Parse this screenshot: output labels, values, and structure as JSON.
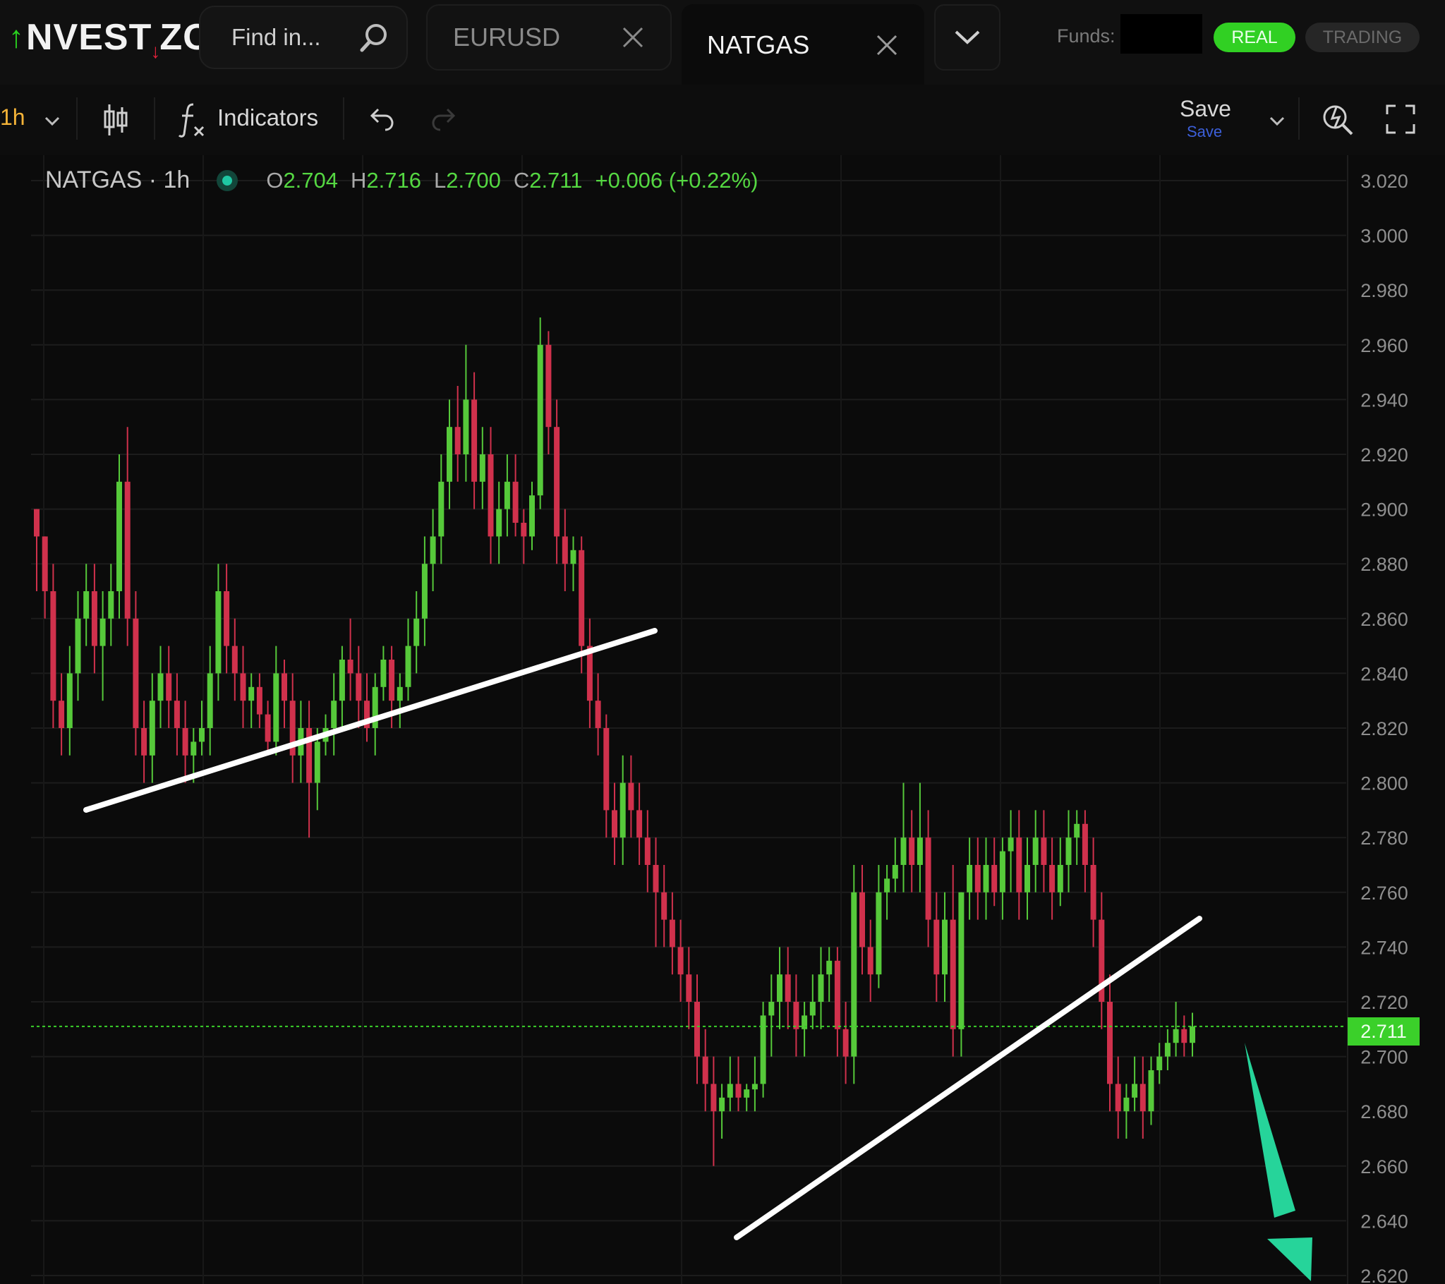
{
  "app": {
    "brand": "INVESTIZO"
  },
  "search": {
    "placeholder": "Find in..."
  },
  "tabs": [
    {
      "label": "EURUSD",
      "active": false
    },
    {
      "label": "NATGAS",
      "active": true
    }
  ],
  "account": {
    "funds_label": "Funds:",
    "mode_real": "REAL",
    "mode_trading": "TRADING"
  },
  "toolbar": {
    "interval": "1h",
    "indicators_label": "Indicators",
    "save_label": "Save",
    "save_sub": "Save"
  },
  "legend": {
    "symbol": "NATGAS · 1h",
    "open_prefix": "O",
    "open": "2.704",
    "high_prefix": "H",
    "high": "2.716",
    "low_prefix": "L",
    "low": "2.700",
    "close_prefix": "C",
    "close": "2.711",
    "change": "+0.006 (+0.22%)"
  },
  "colors": {
    "up": "#56c93a",
    "down": "#d0314c",
    "accent": "#31d023",
    "last_price": "#3bd02a"
  },
  "chart_data": {
    "type": "candlestick",
    "symbol": "NATGAS",
    "timeframe": "1h",
    "ylim": [
      2.62,
      3.02
    ],
    "y_ticks": [
      "3.020",
      "3.000",
      "2.980",
      "2.960",
      "2.940",
      "2.920",
      "2.900",
      "2.880",
      "2.860",
      "2.840",
      "2.820",
      "2.800",
      "2.780",
      "2.760",
      "2.740",
      "2.720",
      "2.700",
      "2.680",
      "2.660",
      "2.640",
      "2.620"
    ],
    "last_price": "2.711",
    "series": [
      {
        "values": [
          [
            2.9,
            2.9,
            2.87,
            2.89
          ],
          [
            2.89,
            2.89,
            2.86,
            2.87
          ],
          [
            2.87,
            2.88,
            2.82,
            2.83
          ],
          [
            2.83,
            2.84,
            2.81,
            2.82
          ],
          [
            2.82,
            2.85,
            2.81,
            2.84
          ],
          [
            2.84,
            2.87,
            2.83,
            2.86
          ],
          [
            2.86,
            2.88,
            2.85,
            2.87
          ],
          [
            2.87,
            2.88,
            2.84,
            2.85
          ],
          [
            2.85,
            2.87,
            2.83,
            2.86
          ],
          [
            2.86,
            2.88,
            2.85,
            2.87
          ],
          [
            2.87,
            2.92,
            2.86,
            2.91
          ],
          [
            2.91,
            2.93,
            2.85,
            2.86
          ],
          [
            2.86,
            2.87,
            2.81,
            2.82
          ],
          [
            2.82,
            2.83,
            2.8,
            2.81
          ],
          [
            2.81,
            2.84,
            2.8,
            2.83
          ],
          [
            2.83,
            2.85,
            2.82,
            2.84
          ],
          [
            2.84,
            2.85,
            2.82,
            2.83
          ],
          [
            2.83,
            2.84,
            2.81,
            2.82
          ],
          [
            2.82,
            2.83,
            2.8,
            2.81
          ],
          [
            2.81,
            2.82,
            2.8,
            2.815
          ],
          [
            2.815,
            2.83,
            2.81,
            2.82
          ],
          [
            2.82,
            2.85,
            2.81,
            2.84
          ],
          [
            2.84,
            2.88,
            2.83,
            2.87
          ],
          [
            2.87,
            2.88,
            2.84,
            2.85
          ],
          [
            2.85,
            2.86,
            2.83,
            2.84
          ],
          [
            2.84,
            2.85,
            2.82,
            2.83
          ],
          [
            2.83,
            2.84,
            2.82,
            2.835
          ],
          [
            2.835,
            2.84,
            2.82,
            2.825
          ],
          [
            2.825,
            2.83,
            2.81,
            2.815
          ],
          [
            2.815,
            2.85,
            2.81,
            2.84
          ],
          [
            2.84,
            2.845,
            2.82,
            2.83
          ],
          [
            2.83,
            2.84,
            2.8,
            2.81
          ],
          [
            2.81,
            2.83,
            2.8,
            2.82
          ],
          [
            2.82,
            2.83,
            2.78,
            2.8
          ],
          [
            2.8,
            2.82,
            2.79,
            2.815
          ],
          [
            2.815,
            2.825,
            2.81,
            2.82
          ],
          [
            2.82,
            2.84,
            2.81,
            2.83
          ],
          [
            2.83,
            2.85,
            2.82,
            2.845
          ],
          [
            2.845,
            2.86,
            2.83,
            2.84
          ],
          [
            2.84,
            2.85,
            2.82,
            2.83
          ],
          [
            2.83,
            2.84,
            2.815,
            2.82
          ],
          [
            2.82,
            2.84,
            2.81,
            2.835
          ],
          [
            2.835,
            2.85,
            2.83,
            2.845
          ],
          [
            2.845,
            2.85,
            2.82,
            2.83
          ],
          [
            2.83,
            2.84,
            2.82,
            2.835
          ],
          [
            2.835,
            2.86,
            2.83,
            2.85
          ],
          [
            2.85,
            2.87,
            2.84,
            2.86
          ],
          [
            2.86,
            2.89,
            2.85,
            2.88
          ],
          [
            2.88,
            2.9,
            2.87,
            2.89
          ],
          [
            2.89,
            2.92,
            2.88,
            2.91
          ],
          [
            2.91,
            2.94,
            2.9,
            2.93
          ],
          [
            2.93,
            2.945,
            2.91,
            2.92
          ],
          [
            2.92,
            2.96,
            2.91,
            2.94
          ],
          [
            2.94,
            2.95,
            2.9,
            2.91
          ],
          [
            2.91,
            2.93,
            2.9,
            2.92
          ],
          [
            2.92,
            2.93,
            2.88,
            2.89
          ],
          [
            2.89,
            2.91,
            2.88,
            2.9
          ],
          [
            2.9,
            2.92,
            2.89,
            2.91
          ],
          [
            2.91,
            2.92,
            2.89,
            2.895
          ],
          [
            2.895,
            2.9,
            2.88,
            2.89
          ],
          [
            2.89,
            2.91,
            2.885,
            2.905
          ],
          [
            2.905,
            2.97,
            2.9,
            2.96
          ],
          [
            2.96,
            2.965,
            2.92,
            2.93
          ],
          [
            2.93,
            2.94,
            2.88,
            2.89
          ],
          [
            2.89,
            2.9,
            2.87,
            2.88
          ],
          [
            2.88,
            2.89,
            2.87,
            2.885
          ],
          [
            2.885,
            2.89,
            2.84,
            2.85
          ],
          [
            2.85,
            2.86,
            2.82,
            2.83
          ],
          [
            2.83,
            2.84,
            2.81,
            2.82
          ],
          [
            2.82,
            2.825,
            2.78,
            2.79
          ],
          [
            2.79,
            2.8,
            2.77,
            2.78
          ],
          [
            2.78,
            2.81,
            2.77,
            2.8
          ],
          [
            2.8,
            2.81,
            2.78,
            2.79
          ],
          [
            2.79,
            2.8,
            2.77,
            2.78
          ],
          [
            2.78,
            2.79,
            2.76,
            2.77
          ],
          [
            2.77,
            2.78,
            2.74,
            2.76
          ],
          [
            2.76,
            2.77,
            2.74,
            2.75
          ],
          [
            2.75,
            2.76,
            2.73,
            2.74
          ],
          [
            2.74,
            2.75,
            2.72,
            2.73
          ],
          [
            2.73,
            2.74,
            2.71,
            2.72
          ],
          [
            2.72,
            2.73,
            2.69,
            2.7
          ],
          [
            2.7,
            2.71,
            2.68,
            2.69
          ],
          [
            2.69,
            2.7,
            2.66,
            2.68
          ],
          [
            2.68,
            2.69,
            2.67,
            2.685
          ],
          [
            2.685,
            2.7,
            2.68,
            2.69
          ],
          [
            2.69,
            2.7,
            2.68,
            2.685
          ],
          [
            2.685,
            2.69,
            2.68,
            2.688
          ],
          [
            2.688,
            2.7,
            2.68,
            2.69
          ],
          [
            2.69,
            2.72,
            2.685,
            2.715
          ],
          [
            2.715,
            2.73,
            2.7,
            2.72
          ],
          [
            2.72,
            2.74,
            2.71,
            2.73
          ],
          [
            2.73,
            2.74,
            2.71,
            2.72
          ],
          [
            2.72,
            2.73,
            2.7,
            2.71
          ],
          [
            2.71,
            2.72,
            2.7,
            2.715
          ],
          [
            2.715,
            2.73,
            2.71,
            2.72
          ],
          [
            2.72,
            2.74,
            2.71,
            2.73
          ],
          [
            2.73,
            2.74,
            2.72,
            2.735
          ],
          [
            2.735,
            2.74,
            2.7,
            2.71
          ],
          [
            2.71,
            2.72,
            2.69,
            2.7
          ],
          [
            2.7,
            2.77,
            2.69,
            2.76
          ],
          [
            2.76,
            2.77,
            2.73,
            2.74
          ],
          [
            2.74,
            2.75,
            2.72,
            2.73
          ],
          [
            2.73,
            2.77,
            2.725,
            2.76
          ],
          [
            2.76,
            2.77,
            2.75,
            2.765
          ],
          [
            2.765,
            2.78,
            2.76,
            2.77
          ],
          [
            2.77,
            2.8,
            2.76,
            2.78
          ],
          [
            2.78,
            2.79,
            2.76,
            2.77
          ],
          [
            2.77,
            2.8,
            2.76,
            2.78
          ],
          [
            2.78,
            2.79,
            2.74,
            2.75
          ],
          [
            2.75,
            2.76,
            2.72,
            2.73
          ],
          [
            2.73,
            2.76,
            2.72,
            2.75
          ],
          [
            2.75,
            2.77,
            2.7,
            2.71
          ],
          [
            2.71,
            2.76,
            2.7,
            2.76
          ],
          [
            2.76,
            2.78,
            2.75,
            2.77
          ],
          [
            2.77,
            2.78,
            2.75,
            2.76
          ],
          [
            2.76,
            2.78,
            2.75,
            2.77
          ],
          [
            2.77,
            2.78,
            2.755,
            2.76
          ],
          [
            2.76,
            2.78,
            2.75,
            2.775
          ],
          [
            2.775,
            2.79,
            2.76,
            2.78
          ],
          [
            2.78,
            2.79,
            2.75,
            2.76
          ],
          [
            2.76,
            2.78,
            2.75,
            2.77
          ],
          [
            2.77,
            2.79,
            2.76,
            2.78
          ],
          [
            2.78,
            2.79,
            2.76,
            2.77
          ],
          [
            2.77,
            2.78,
            2.75,
            2.76
          ],
          [
            2.76,
            2.78,
            2.755,
            2.77
          ],
          [
            2.77,
            2.79,
            2.76,
            2.78
          ],
          [
            2.78,
            2.79,
            2.77,
            2.785
          ],
          [
            2.785,
            2.79,
            2.76,
            2.77
          ],
          [
            2.77,
            2.78,
            2.74,
            2.75
          ],
          [
            2.75,
            2.76,
            2.71,
            2.72
          ],
          [
            2.72,
            2.73,
            2.68,
            2.69
          ],
          [
            2.69,
            2.7,
            2.67,
            2.68
          ],
          [
            2.68,
            2.69,
            2.67,
            2.685
          ],
          [
            2.685,
            2.7,
            2.68,
            2.69
          ],
          [
            2.69,
            2.7,
            2.67,
            2.68
          ],
          [
            2.68,
            2.7,
            2.675,
            2.695
          ],
          [
            2.695,
            2.705,
            2.69,
            2.7
          ],
          [
            2.7,
            2.71,
            2.695,
            2.705
          ],
          [
            2.705,
            2.72,
            2.7,
            2.71
          ],
          [
            2.71,
            2.715,
            2.7,
            2.705
          ],
          [
            2.705,
            2.716,
            2.7,
            2.711
          ]
        ]
      }
    ]
  }
}
